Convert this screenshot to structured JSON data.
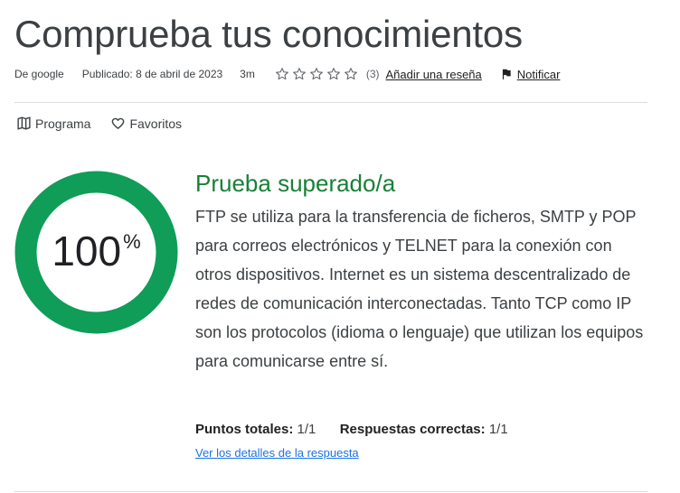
{
  "page": {
    "title": "Comprueba tus conocimientos"
  },
  "meta": {
    "author": "De google",
    "published": "Publicado: 8 de abril de 2023",
    "duration": "3m",
    "rating_stars": 0,
    "rating_count": "(3)",
    "add_review": "Añadir una reseña",
    "report": "Notificar",
    "star_icon": "star-outline-icon",
    "flag_icon": "flag-icon"
  },
  "tabs": [
    {
      "label": "Programa",
      "icon": "map-icon"
    },
    {
      "label": "Favoritos",
      "icon": "heart-icon"
    }
  ],
  "result": {
    "score_value": "100",
    "score_unit": "%",
    "progress_fraction": 1.0,
    "ring_color": "#0f9d58",
    "status_title": "Prueba superado/a",
    "explanation": "FTP se utiliza para la transferencia de ficheros, SMTP y POP para correos electrónicos y TELNET para la conexión con otros dispositivos. Internet es un sistema descentralizado de redes de comunicación interconectadas. Tanto TCP como IP son los protocolos (idioma o lenguaje) que utilizan los equipos para comunicarse entre sí.",
    "total_points_label": "Puntos totales:",
    "total_points_value": "1/1",
    "correct_answers_label": "Respuestas correctas:",
    "correct_answers_value": "1/1",
    "details_link": "Ver los detalles de la respuesta"
  }
}
